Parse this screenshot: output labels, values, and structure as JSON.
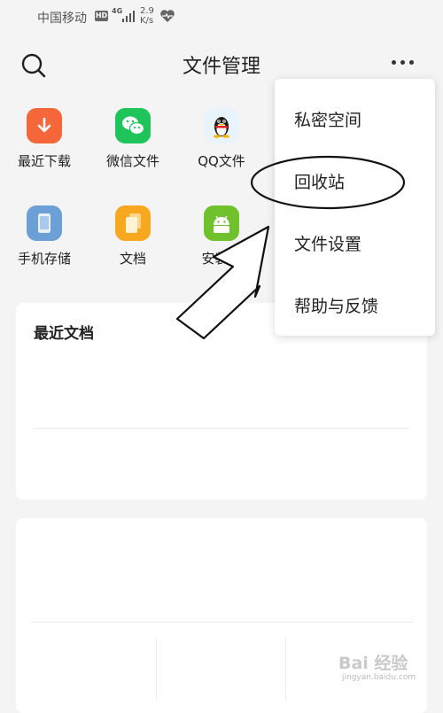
{
  "status_bar": {
    "carrier": "中国移动",
    "hd": "HD",
    "network": "4G",
    "speed_value": "2.9",
    "speed_unit": "K/s"
  },
  "header": {
    "title": "文件管理"
  },
  "quick_access": [
    {
      "label": "最近下载",
      "icon": "download-icon",
      "color": "#f5673a"
    },
    {
      "label": "微信文件",
      "icon": "wechat-icon",
      "color": "#1fc45a"
    },
    {
      "label": "QQ文件",
      "icon": "qq-icon",
      "color": "#e9f3fb"
    },
    {
      "label": "手机存储",
      "icon": "phone-storage-icon",
      "color": "#6c9fd6"
    },
    {
      "label": "文档",
      "icon": "document-icon",
      "color": "#f7a81e"
    },
    {
      "label": "安装包",
      "icon": "android-icon",
      "color": "#6fc22c"
    }
  ],
  "recent_docs": {
    "title": "最近文档"
  },
  "menu": {
    "items": [
      {
        "label": "私密空间"
      },
      {
        "label": "回收站"
      },
      {
        "label": "文件设置"
      },
      {
        "label": "帮助与反馈"
      }
    ]
  },
  "watermark": {
    "brand": "Bai 经验",
    "site": "jingyan.baidu.com"
  }
}
